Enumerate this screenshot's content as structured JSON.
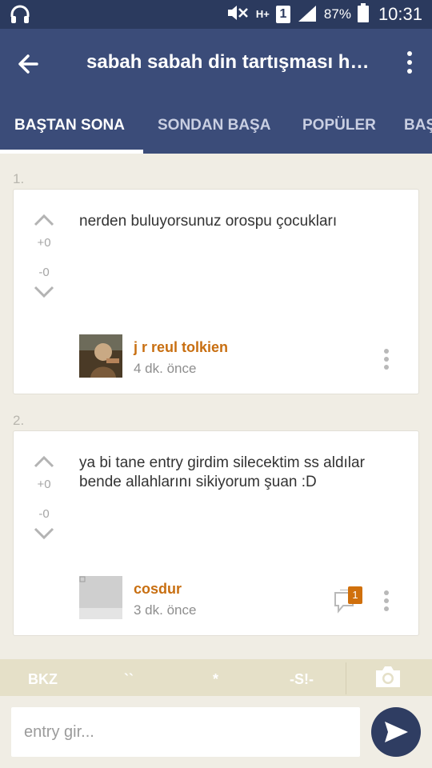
{
  "status_bar": {
    "headset_icon": "headphones-icon",
    "network_type": "H+",
    "sim_slot": "1",
    "battery_percent": "87%",
    "time": "10:31"
  },
  "app_bar": {
    "title": "sabah sabah din tartışması hakkında"
  },
  "tabs": [
    {
      "label": "BAŞTAN SONA",
      "active": true
    },
    {
      "label": "SONDAN BAŞA",
      "active": false
    },
    {
      "label": "POPÜLER",
      "active": false
    },
    {
      "label": "BAŞ",
      "active": false
    }
  ],
  "entries": [
    {
      "number": "1.",
      "text": "nerden buluyorsunuz orospu çocukları",
      "upvotes": "+0",
      "downvotes": "-0",
      "author": "j r reul tolkien",
      "time": "4 dk. önce"
    },
    {
      "number": "2.",
      "text": "ya bi tane entry girdim silecektim ss aldılar bende allahlarını sikiyorum şuan :D",
      "upvotes": "+0",
      "downvotes": "-0",
      "author": "cosdur",
      "time": "3 dk. önce",
      "comment_count": "1"
    }
  ],
  "shortcuts": {
    "bkz": "BKZ",
    "hidden": "``",
    "star": "*",
    "spoiler": "-S!-"
  },
  "composer": {
    "placeholder": "entry gir..."
  },
  "colors": {
    "status_bar": "#2b3a5e",
    "app_bar": "#3b4c79",
    "author": "#c86f11",
    "badge": "#d0700c",
    "send": "#2f3d62"
  }
}
